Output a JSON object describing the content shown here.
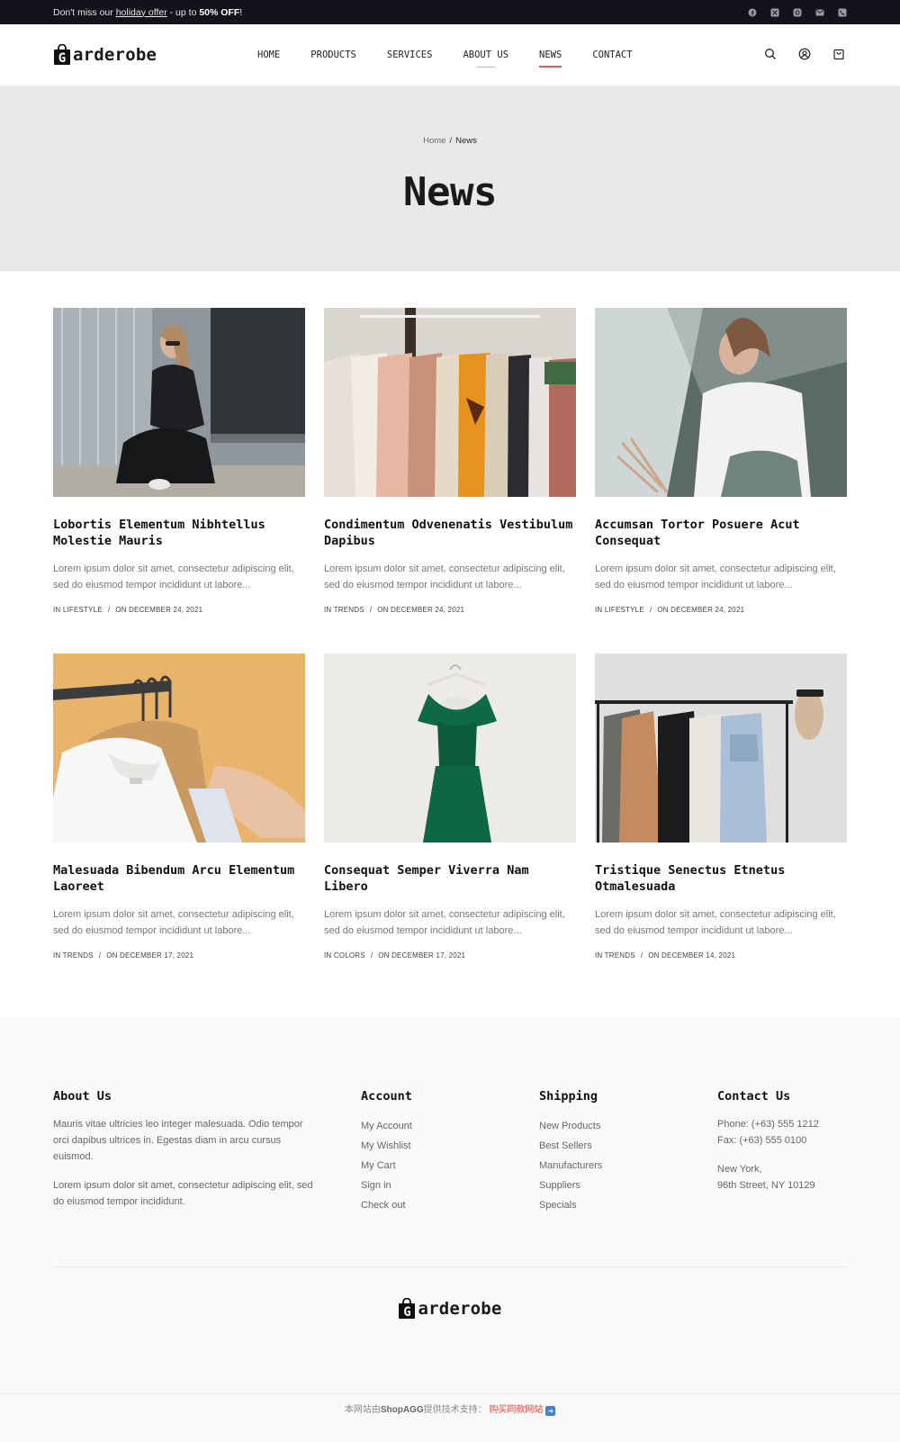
{
  "topbar": {
    "promo_prefix": "Don't miss our ",
    "promo_link": "holiday offer",
    "promo_mid": " - up to ",
    "promo_bold": "50% OFF",
    "promo_suffix": "!",
    "social_icons": [
      "facebook-icon",
      "x-icon",
      "instagram-icon",
      "mail-icon",
      "phone-icon"
    ]
  },
  "header": {
    "logo_letter": "G",
    "logo_text": "arderobe",
    "nav": [
      {
        "label": "HOME"
      },
      {
        "label": "PRODUCTS"
      },
      {
        "label": "SERVICES"
      },
      {
        "label": "ABOUT US"
      },
      {
        "label": "NEWS"
      },
      {
        "label": "CONTACT"
      }
    ],
    "icons": [
      "search-icon",
      "user-icon",
      "cart-icon"
    ]
  },
  "hero": {
    "breadcrumb_home": "Home",
    "breadcrumb_sep": "/",
    "breadcrumb_current": "News",
    "title": "News"
  },
  "posts": [
    {
      "title": "Lobortis Elementum Nibhtellus Molestie Mauris",
      "excerpt": "Lorem ipsum dolor sit amet, consectetur adipiscing elit, sed do eiusmod tempor incididunt ut labore...",
      "category": "IN LIFESTYLE",
      "date": "ON DECEMBER 24, 2021"
    },
    {
      "title": "Condimentum Odvenenatis Vestibulum Dapibus",
      "excerpt": "Lorem ipsum dolor sit amet, consectetur adipiscing elit, sed do eiusmod tempor incididunt ut labore...",
      "category": "IN TRENDS",
      "date": "ON DECEMBER 24, 2021"
    },
    {
      "title": "Accumsan Tortor Posuere Acut Consequat",
      "excerpt": "Lorem ipsum dolor sit amet, consectetur adipiscing elit, sed do eiusmod tempor incididunt ut labore...",
      "category": "IN LIFESTYLE",
      "date": "ON DECEMBER 24, 2021"
    },
    {
      "title": "Malesuada Bibendum Arcu Elementum Laoreet",
      "excerpt": "Lorem ipsum dolor sit amet, consectetur adipiscing elit, sed do eiusmod tempor incididunt ut labore...",
      "category": "IN TRENDS",
      "date": "ON DECEMBER 17, 2021"
    },
    {
      "title": "Consequat Semper Viverra Nam Libero",
      "excerpt": "Lorem ipsum dolor sit amet, consectetur adipiscing elit, sed do eiusmod tempor incididunt ut labore...",
      "category": "IN COLORS",
      "date": "ON DECEMBER 17, 2021"
    },
    {
      "title": "Tristique Senectus Etnetus Otmalesuada",
      "excerpt": "Lorem ipsum dolor sit amet, consectetur adipiscing elit, sed do eiusmod tempor incididunt ut labore...",
      "category": "IN TRENDS",
      "date": "ON DECEMBER 14, 2021"
    }
  ],
  "meta_sep": "/",
  "footer": {
    "about": {
      "heading": "About Us",
      "p1": "Mauris vitae ultricies leo integer malesuada. Odio tempor orci dapibus ultrices in. Egestas diam in arcu cursus euismod.",
      "p2": "Lorem ipsum dolor sit amet, consectetur adipiscing elit, sed do eiusmod tempor incididunt."
    },
    "account": {
      "heading": "Account",
      "links": [
        "My Account",
        "My Wishlist",
        "My Cart",
        "Sign in",
        "Check out"
      ]
    },
    "shipping": {
      "heading": "Shipping",
      "links": [
        "New Products",
        "Best Sellers",
        "Manufacturers",
        "Suppliers",
        "Specials"
      ]
    },
    "contact": {
      "heading": "Contact Us",
      "phone": "Phone: (+63) 555 1212",
      "fax": "Fax: (+63) 555 0100",
      "city": "New York,",
      "street": "96th Street, NY 10129"
    },
    "copyright_prefix": "本网站由",
    "copyright_brand": "ShopAGG",
    "copyright_mid": "提供技术支持：",
    "copyright_link": "购买同款网站"
  },
  "colors": {
    "accent": "#e05a4e",
    "topbar_bg": "#14131c",
    "hero_bg": "#e9e9e9",
    "footer_bg": "#f9f9f9"
  }
}
